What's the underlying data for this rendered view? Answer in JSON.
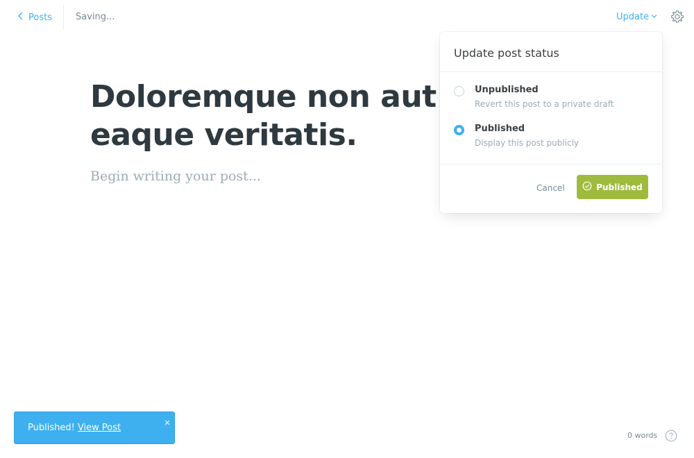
{
  "header": {
    "back_label": "Posts",
    "status_text": "Saving...",
    "update_label": "Update"
  },
  "editor": {
    "title": "Doloremque non aut ve\neaque veritatis.",
    "body_placeholder": "Begin writing your post..."
  },
  "popover": {
    "title": "Update post status",
    "options": [
      {
        "label": "Unpublished",
        "description": "Revert this post to a private draft",
        "selected": false
      },
      {
        "label": "Published",
        "description": "Display this post publicly",
        "selected": true
      }
    ],
    "cancel_label": "Cancel",
    "confirm_label": "Published"
  },
  "toast": {
    "message": "Published!",
    "link_label": "View Post"
  },
  "footer": {
    "word_count": "0 words"
  },
  "colors": {
    "accent": "#3eb0ef",
    "success": "#9fbb3e",
    "title_text": "#2e3940",
    "placeholder_text": "#9aabb5"
  },
  "icons": {
    "back": "chevron-left-icon",
    "update_dropdown": "chevron-down-icon",
    "settings": "gear-icon",
    "confirm": "check-circle-icon",
    "toast_close": "close-icon",
    "help": "help-circle-icon"
  }
}
